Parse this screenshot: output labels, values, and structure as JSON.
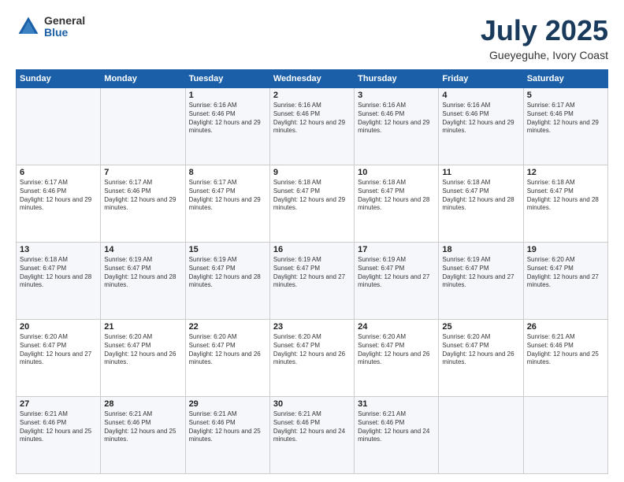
{
  "logo": {
    "general": "General",
    "blue": "Blue"
  },
  "title": "July 2025",
  "subtitle": "Gueyeguhe, Ivory Coast",
  "days_of_week": [
    "Sunday",
    "Monday",
    "Tuesday",
    "Wednesday",
    "Thursday",
    "Friday",
    "Saturday"
  ],
  "weeks": [
    [
      {
        "day": "",
        "sunrise": "",
        "sunset": "",
        "daylight": ""
      },
      {
        "day": "",
        "sunrise": "",
        "sunset": "",
        "daylight": ""
      },
      {
        "day": "1",
        "sunrise": "Sunrise: 6:16 AM",
        "sunset": "Sunset: 6:46 PM",
        "daylight": "Daylight: 12 hours and 29 minutes."
      },
      {
        "day": "2",
        "sunrise": "Sunrise: 6:16 AM",
        "sunset": "Sunset: 6:46 PM",
        "daylight": "Daylight: 12 hours and 29 minutes."
      },
      {
        "day": "3",
        "sunrise": "Sunrise: 6:16 AM",
        "sunset": "Sunset: 6:46 PM",
        "daylight": "Daylight: 12 hours and 29 minutes."
      },
      {
        "day": "4",
        "sunrise": "Sunrise: 6:16 AM",
        "sunset": "Sunset: 6:46 PM",
        "daylight": "Daylight: 12 hours and 29 minutes."
      },
      {
        "day": "5",
        "sunrise": "Sunrise: 6:17 AM",
        "sunset": "Sunset: 6:46 PM",
        "daylight": "Daylight: 12 hours and 29 minutes."
      }
    ],
    [
      {
        "day": "6",
        "sunrise": "Sunrise: 6:17 AM",
        "sunset": "Sunset: 6:46 PM",
        "daylight": "Daylight: 12 hours and 29 minutes."
      },
      {
        "day": "7",
        "sunrise": "Sunrise: 6:17 AM",
        "sunset": "Sunset: 6:46 PM",
        "daylight": "Daylight: 12 hours and 29 minutes."
      },
      {
        "day": "8",
        "sunrise": "Sunrise: 6:17 AM",
        "sunset": "Sunset: 6:47 PM",
        "daylight": "Daylight: 12 hours and 29 minutes."
      },
      {
        "day": "9",
        "sunrise": "Sunrise: 6:18 AM",
        "sunset": "Sunset: 6:47 PM",
        "daylight": "Daylight: 12 hours and 29 minutes."
      },
      {
        "day": "10",
        "sunrise": "Sunrise: 6:18 AM",
        "sunset": "Sunset: 6:47 PM",
        "daylight": "Daylight: 12 hours and 28 minutes."
      },
      {
        "day": "11",
        "sunrise": "Sunrise: 6:18 AM",
        "sunset": "Sunset: 6:47 PM",
        "daylight": "Daylight: 12 hours and 28 minutes."
      },
      {
        "day": "12",
        "sunrise": "Sunrise: 6:18 AM",
        "sunset": "Sunset: 6:47 PM",
        "daylight": "Daylight: 12 hours and 28 minutes."
      }
    ],
    [
      {
        "day": "13",
        "sunrise": "Sunrise: 6:18 AM",
        "sunset": "Sunset: 6:47 PM",
        "daylight": "Daylight: 12 hours and 28 minutes."
      },
      {
        "day": "14",
        "sunrise": "Sunrise: 6:19 AM",
        "sunset": "Sunset: 6:47 PM",
        "daylight": "Daylight: 12 hours and 28 minutes."
      },
      {
        "day": "15",
        "sunrise": "Sunrise: 6:19 AM",
        "sunset": "Sunset: 6:47 PM",
        "daylight": "Daylight: 12 hours and 28 minutes."
      },
      {
        "day": "16",
        "sunrise": "Sunrise: 6:19 AM",
        "sunset": "Sunset: 6:47 PM",
        "daylight": "Daylight: 12 hours and 27 minutes."
      },
      {
        "day": "17",
        "sunrise": "Sunrise: 6:19 AM",
        "sunset": "Sunset: 6:47 PM",
        "daylight": "Daylight: 12 hours and 27 minutes."
      },
      {
        "day": "18",
        "sunrise": "Sunrise: 6:19 AM",
        "sunset": "Sunset: 6:47 PM",
        "daylight": "Daylight: 12 hours and 27 minutes."
      },
      {
        "day": "19",
        "sunrise": "Sunrise: 6:20 AM",
        "sunset": "Sunset: 6:47 PM",
        "daylight": "Daylight: 12 hours and 27 minutes."
      }
    ],
    [
      {
        "day": "20",
        "sunrise": "Sunrise: 6:20 AM",
        "sunset": "Sunset: 6:47 PM",
        "daylight": "Daylight: 12 hours and 27 minutes."
      },
      {
        "day": "21",
        "sunrise": "Sunrise: 6:20 AM",
        "sunset": "Sunset: 6:47 PM",
        "daylight": "Daylight: 12 hours and 26 minutes."
      },
      {
        "day": "22",
        "sunrise": "Sunrise: 6:20 AM",
        "sunset": "Sunset: 6:47 PM",
        "daylight": "Daylight: 12 hours and 26 minutes."
      },
      {
        "day": "23",
        "sunrise": "Sunrise: 6:20 AM",
        "sunset": "Sunset: 6:47 PM",
        "daylight": "Daylight: 12 hours and 26 minutes."
      },
      {
        "day": "24",
        "sunrise": "Sunrise: 6:20 AM",
        "sunset": "Sunset: 6:47 PM",
        "daylight": "Daylight: 12 hours and 26 minutes."
      },
      {
        "day": "25",
        "sunrise": "Sunrise: 6:20 AM",
        "sunset": "Sunset: 6:47 PM",
        "daylight": "Daylight: 12 hours and 26 minutes."
      },
      {
        "day": "26",
        "sunrise": "Sunrise: 6:21 AM",
        "sunset": "Sunset: 6:46 PM",
        "daylight": "Daylight: 12 hours and 25 minutes."
      }
    ],
    [
      {
        "day": "27",
        "sunrise": "Sunrise: 6:21 AM",
        "sunset": "Sunset: 6:46 PM",
        "daylight": "Daylight: 12 hours and 25 minutes."
      },
      {
        "day": "28",
        "sunrise": "Sunrise: 6:21 AM",
        "sunset": "Sunset: 6:46 PM",
        "daylight": "Daylight: 12 hours and 25 minutes."
      },
      {
        "day": "29",
        "sunrise": "Sunrise: 6:21 AM",
        "sunset": "Sunset: 6:46 PM",
        "daylight": "Daylight: 12 hours and 25 minutes."
      },
      {
        "day": "30",
        "sunrise": "Sunrise: 6:21 AM",
        "sunset": "Sunset: 6:46 PM",
        "daylight": "Daylight: 12 hours and 24 minutes."
      },
      {
        "day": "31",
        "sunrise": "Sunrise: 6:21 AM",
        "sunset": "Sunset: 6:46 PM",
        "daylight": "Daylight: 12 hours and 24 minutes."
      },
      {
        "day": "",
        "sunrise": "",
        "sunset": "",
        "daylight": ""
      },
      {
        "day": "",
        "sunrise": "",
        "sunset": "",
        "daylight": ""
      }
    ]
  ]
}
